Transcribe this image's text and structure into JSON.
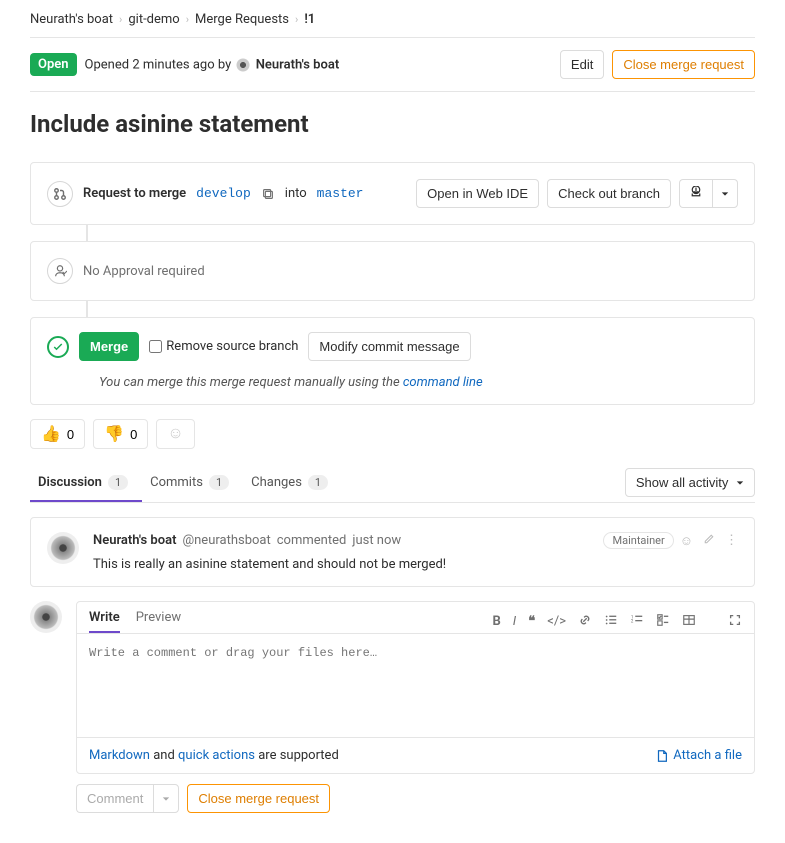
{
  "breadcrumbs": {
    "owner": "Neurath's boat",
    "repo": "git-demo",
    "section": "Merge Requests",
    "id": "!1"
  },
  "header": {
    "status": "Open",
    "opened_prefix": "Opened",
    "opened_ago": "2 minutes ago",
    "by": "by",
    "author": "Neurath's boat",
    "edit": "Edit",
    "close": "Close merge request"
  },
  "title": "Include asinine statement",
  "request": {
    "label": "Request to merge",
    "source": "develop",
    "into": "into",
    "target": "master"
  },
  "actions": {
    "web_ide": "Open in Web IDE",
    "checkout": "Check out branch"
  },
  "approval": "No Approval required",
  "merge": {
    "button": "Merge",
    "remove": "Remove source branch",
    "modify": "Modify commit message",
    "manual_prefix": "You can merge this merge request manually using the",
    "manual_link": "command line"
  },
  "reactions": {
    "up": "0",
    "down": "0"
  },
  "tabs": {
    "discussion": "Discussion",
    "discussion_count": "1",
    "commits": "Commits",
    "commits_count": "1",
    "changes": "Changes",
    "changes_count": "1",
    "filter": "Show all activity"
  },
  "discussion": {
    "author": "Neurath's boat",
    "handle": "@neurathsboat",
    "verb": "commented",
    "time": "just now",
    "role": "Maintainer",
    "body": "This is really an asinine statement and should not be merged!"
  },
  "editor": {
    "write": "Write",
    "preview": "Preview",
    "placeholder": "Write a comment or drag your files here…",
    "markdown": "Markdown",
    "and": "and",
    "quick": "quick actions",
    "supported": "are supported",
    "attach": "Attach a file",
    "comment_btn": "Comment",
    "close_btn": "Close merge request"
  }
}
